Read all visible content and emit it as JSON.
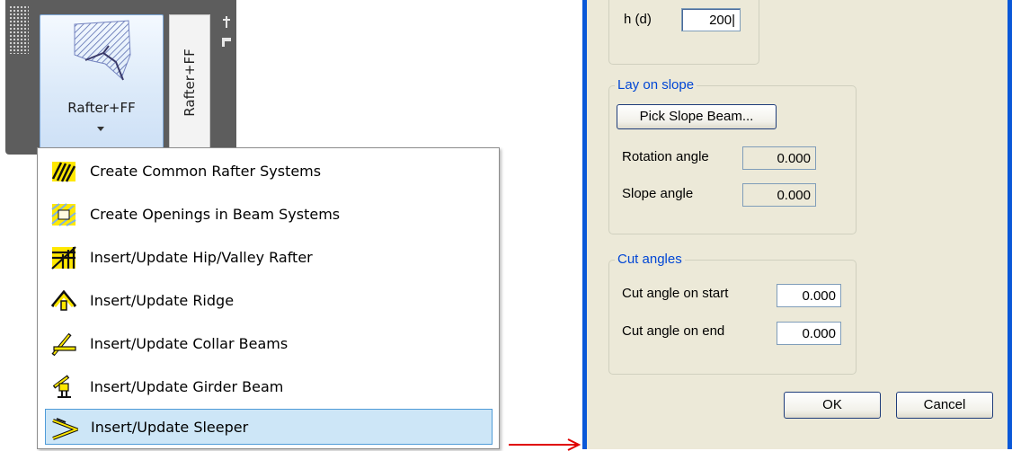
{
  "ribbon": {
    "big_button_label": "Rafter+FF",
    "vertical_tab_label": "Rafter+FF"
  },
  "menu": {
    "items": [
      {
        "label": "Create Common Rafter Systems",
        "icon": "rafter-systems-icon"
      },
      {
        "label": "Create Openings in Beam Systems",
        "icon": "openings-icon"
      },
      {
        "label": "Insert/Update Hip/Valley Rafter",
        "icon": "hip-valley-icon"
      },
      {
        "label": "Insert/Update Ridge",
        "icon": "ridge-icon"
      },
      {
        "label": "Insert/Update Collar Beams",
        "icon": "collar-beams-icon"
      },
      {
        "label": "Insert/Update Girder Beam",
        "icon": "girder-beam-icon"
      },
      {
        "label": "Insert/Update Sleeper",
        "icon": "sleeper-icon",
        "selected": true
      }
    ]
  },
  "dialog": {
    "h_label": "h (d)",
    "h_value": "200",
    "lay_on_slope": {
      "title": "Lay on slope",
      "pick_button": "Pick Slope Beam...",
      "rotation_label": "Rotation angle",
      "rotation_value": "0.000",
      "slope_label": "Slope angle",
      "slope_value": "0.000"
    },
    "cut_angles": {
      "title": "Cut angles",
      "start_label": "Cut angle on start",
      "start_value": "0.000",
      "end_label": "Cut angle on end",
      "end_value": "0.000"
    },
    "ok_label": "OK",
    "cancel_label": "Cancel"
  },
  "colors": {
    "ribbon_bg": "#5d5d5d",
    "selected_item_bg": "#cde6f7",
    "group_title": "#0046d5",
    "dialog_frame": "#0a58d8",
    "arrow": "#e00000"
  }
}
